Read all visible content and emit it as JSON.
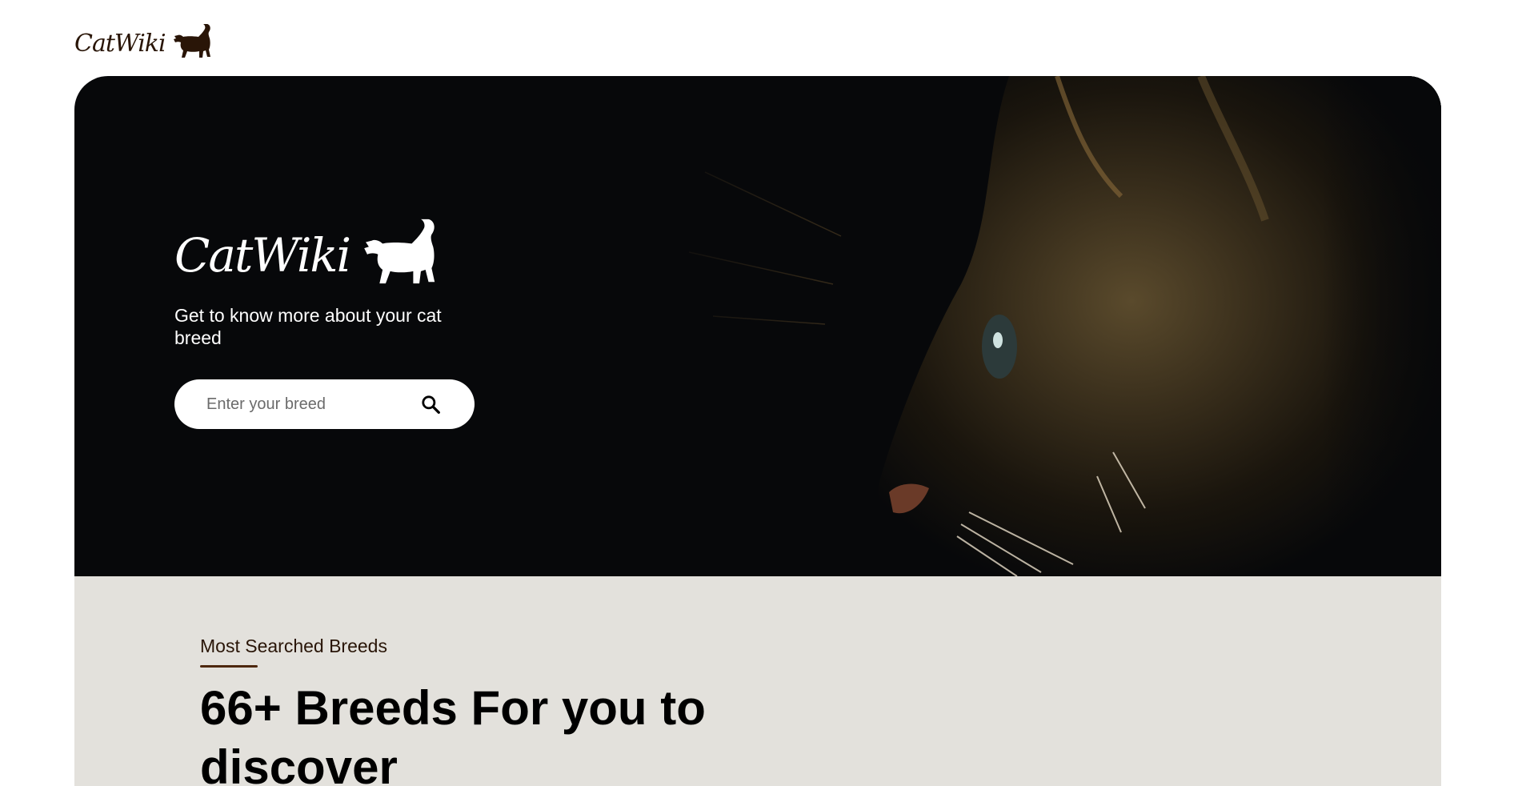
{
  "header": {
    "logo_text": "CatWiki",
    "logo_icon": "cat-silhouette-icon"
  },
  "hero": {
    "logo_text": "CatWiki",
    "logo_icon": "cat-silhouette-icon",
    "tagline": "Get to know more about your cat breed",
    "search": {
      "placeholder": "Enter your breed",
      "value": "",
      "icon": "search-icon"
    },
    "photo": "cat-profile-photo"
  },
  "breeds": {
    "eyebrow": "Most Searched Breeds",
    "headline": "66+ Breeds For you to discover"
  },
  "colors": {
    "brand_dark": "#291507",
    "accent_line": "#4d270c",
    "section_bg": "#e3e1dc",
    "hero_bg": "#07080a"
  }
}
